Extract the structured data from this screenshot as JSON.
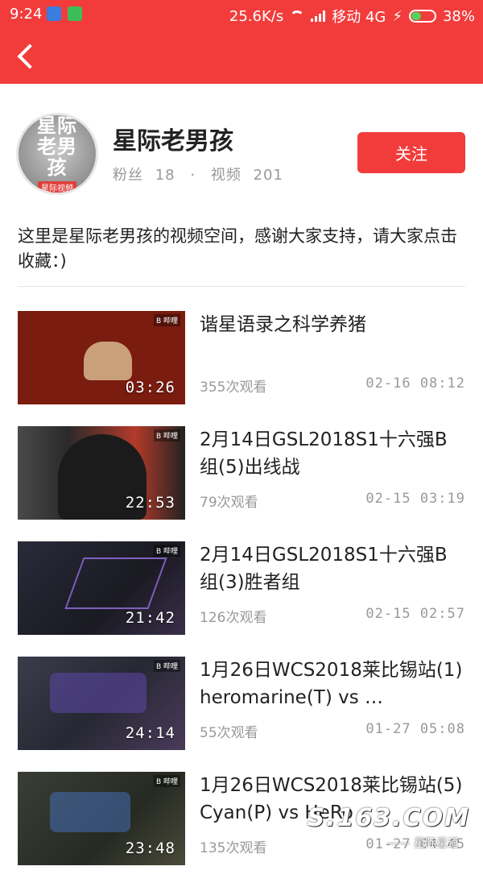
{
  "status_bar": {
    "time": "9:24",
    "network_speed": "25.6K/s",
    "carrier": "移动 4G",
    "battery": "38%"
  },
  "profile": {
    "name": "星际老男孩",
    "avatar_text": "星际老男孩",
    "avatar_tag": "星际视频",
    "fans_label": "粉丝",
    "fans_count": "18",
    "videos_label": "视频",
    "videos_count": "201",
    "follow_label": "关注",
    "description": "这里是星际老男孩的视频空间，感谢大家支持，请大家点击收藏：)"
  },
  "videos": [
    {
      "title": "谐星语录之科学养猪",
      "duration": "03:26",
      "views": "355次观看",
      "date": "02-16 08:12"
    },
    {
      "title": "2月14日GSL2018S1十六强B组(5)出线战",
      "duration": "22:53",
      "views": "79次观看",
      "date": "02-15 03:19"
    },
    {
      "title": "2月14日GSL2018S1十六强B组(3)胜者组",
      "duration": "21:42",
      "views": "126次观看",
      "date": "02-15 02:57"
    },
    {
      "title": "1月26日WCS2018莱比锡站(1) heromarine(T) vs …",
      "duration": "24:14",
      "views": "55次观看",
      "date": "01-27 05:08"
    },
    {
      "title": "1月26日WCS2018莱比锡站(5) Cyan(P) vs HeRo",
      "duration": "23:48",
      "views": "135次观看",
      "date": "01-27 04:45"
    }
  ],
  "thumb_brand": "B 哔哩",
  "watermark": {
    "text": "S.163.COM",
    "sub": "—— 星际星道"
  }
}
